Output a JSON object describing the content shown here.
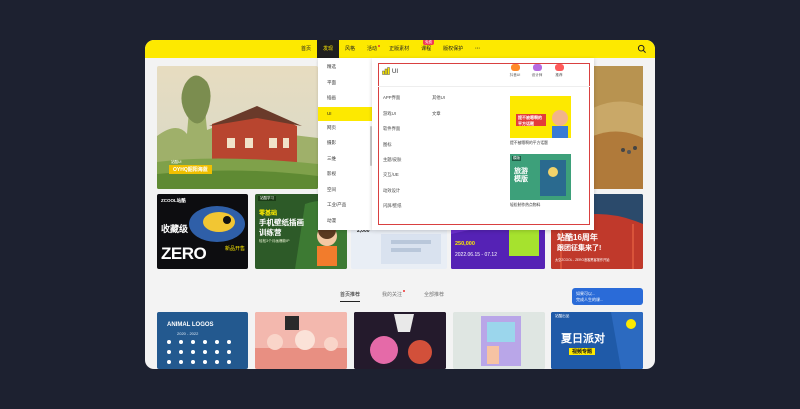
{
  "nav": {
    "items": [
      {
        "label": "首页"
      },
      {
        "label": "发现"
      },
      {
        "label": "风格"
      },
      {
        "label": "活动"
      },
      {
        "label": "正版素材"
      },
      {
        "label": "课程"
      },
      {
        "label": "版权保护"
      },
      {
        "label": "···"
      }
    ],
    "course_badge": "免费"
  },
  "hero": {
    "tag": "站酷UI",
    "caption": "OYHQ韶阳海蓝"
  },
  "dropdown": {
    "categories": [
      "精选",
      "平面",
      "插画",
      "UI",
      "网页",
      "摄影",
      "三维",
      "影视",
      "空间",
      "工业/产品",
      "动漫"
    ],
    "active": "UI",
    "panel_title": "UI",
    "sub_left": [
      "APP界面",
      "游戏UI",
      "软件界面",
      "图标",
      "主题/皮肤",
      "交互/UE",
      "动效设计",
      "闪屏/壁纸"
    ],
    "sub_right": [
      "其他UI",
      "文章"
    ],
    "quick": [
      {
        "label": "抖音UI",
        "color": "#ff8a2a"
      },
      {
        "label": "设计师",
        "color": "#b66ae0"
      },
      {
        "label": "推荐",
        "color": "#ff5a5a"
      }
    ],
    "promo1_label": "提不被嗯啊的平方话题",
    "promo1_text1": "提不被嗯啊的",
    "promo1_text2": "平方话题",
    "promo2_label": "轻松制作热点物料",
    "promo2_title": "旅游模版",
    "promo2_tag": "模版"
  },
  "banners": {
    "b1_logo": "ZCOOL站酷",
    "b1_line1": "收藏级",
    "b1_line2": "ZERO",
    "b1_line3": "新品开售",
    "b2_tag": "站酷学习",
    "b2_line1": "零基础",
    "b2_line2": "手机壁纸插画",
    "b2_line3": "训练营",
    "b2_line4": "轻松3个月画爆款IP",
    "b3_price": "2,000",
    "b4_amount": "250,000",
    "b4_date": "2022.06.15 - 07.12",
    "b5_line1": "站酷16周年",
    "b5_line2": "跟团征集来了!",
    "b5_line3": "太空ZCOOL - ZERO浪客黑客报作开始"
  },
  "tabs": {
    "items": [
      "首页推荐",
      "我的关注",
      "全部推荐"
    ],
    "active": "首页推荐"
  },
  "side_promo": {
    "line1": "如果可以...",
    "line2": "完成人生的课..."
  },
  "cards": {
    "c1_title": "ANIMAL LOGOS",
    "c1_years": "2020 - 2022",
    "c5_tag": "站酷出品",
    "c5_title": "夏日派对",
    "c5_sub": "视频专题"
  },
  "colors": {
    "accent": "#fde900",
    "dark": "#1f1f1f",
    "highlight_frame": "#d94040",
    "page_bg": "#1d2130"
  }
}
